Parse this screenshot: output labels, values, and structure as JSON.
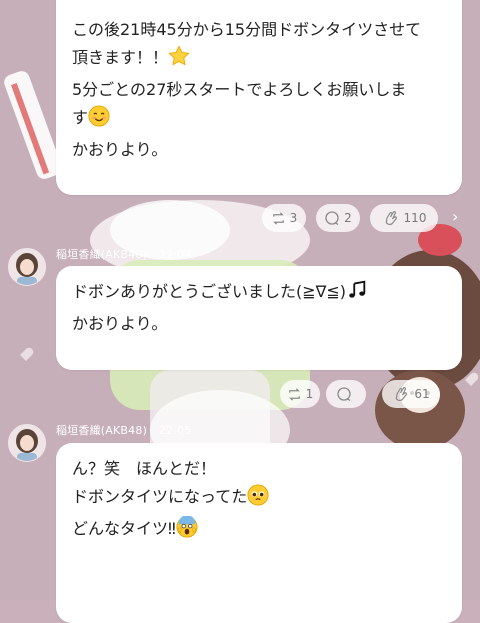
{
  "messages": [
    {
      "lines": [
        "この後21時45分から15分間ドボンタイツさせて",
        "頂きます！！",
        "5分ごとの27秒スタートでよろしくお願いしま",
        "す",
        "",
        "かおりより。"
      ],
      "emoji": {
        "line2": "star-emoji",
        "line4": "smiling-face-emoji"
      },
      "reactions": {
        "repost": "3",
        "comment": "2",
        "clap": "110"
      }
    },
    {
      "author": "稲垣香織(AKB48)",
      "time": "22:04",
      "lines": [
        "ドボンありがとうございました(≧∇≦)",
        "",
        "かおりより。"
      ],
      "emoji": {
        "line1": "music-note-emoji"
      },
      "reactions": {
        "repost": "1",
        "comment": "",
        "clap": "61"
      }
    },
    {
      "author": "稲垣香織(AKB48)",
      "time": "22:05",
      "lines": [
        "ん？笑　ほんとだ！",
        "ドボンタイツになってた",
        "どんなタイツ‼"
      ],
      "emoji": {
        "line2": "pleading-face-emoji",
        "line3": "screaming-face-emoji"
      }
    }
  ]
}
